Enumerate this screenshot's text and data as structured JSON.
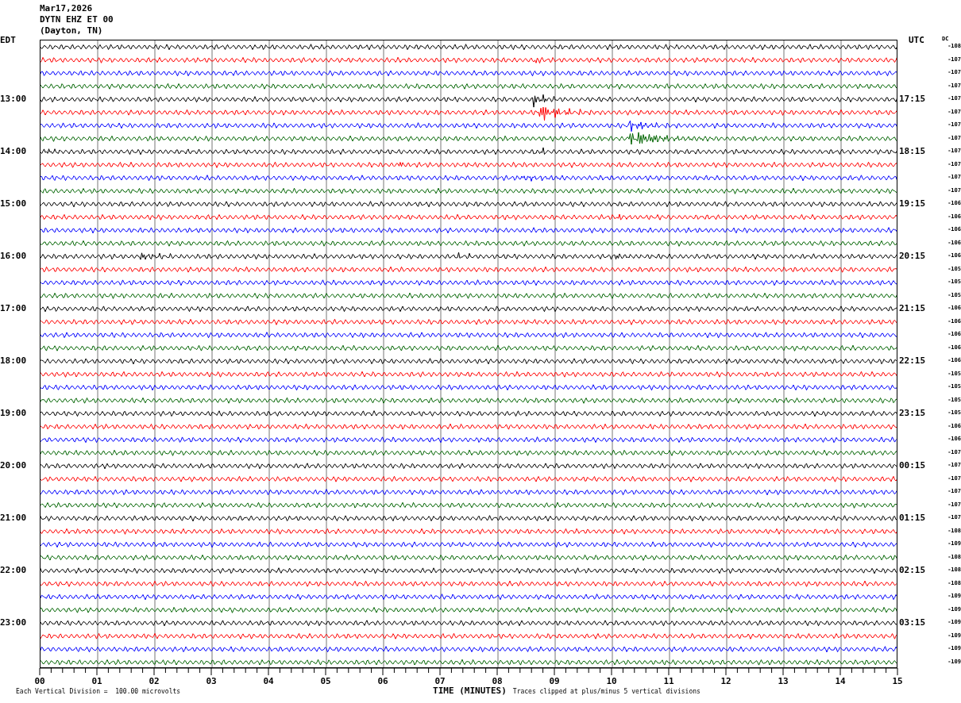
{
  "header": {
    "date": "Mar17,2026",
    "station": "DYTN EHZ ET 00",
    "location": "(Dayton, TN)"
  },
  "left_heading": "EDT",
  "right_heading": "UTC",
  "dc_heading": "DC",
  "rows": [
    {
      "color": "#000000",
      "dc": "-108"
    },
    {
      "color": "#ff0000",
      "dc": "-107"
    },
    {
      "color": "#0000ff",
      "dc": "-107"
    },
    {
      "color": "#006400",
      "dc": "-107"
    },
    {
      "color": "#000000",
      "dc": "-107",
      "left": "13:00",
      "right": "17:15"
    },
    {
      "color": "#ff0000",
      "dc": "-107"
    },
    {
      "color": "#0000ff",
      "dc": "-107"
    },
    {
      "color": "#006400",
      "dc": "-107"
    },
    {
      "color": "#000000",
      "dc": "-107",
      "left": "14:00",
      "right": "18:15"
    },
    {
      "color": "#ff0000",
      "dc": "-107"
    },
    {
      "color": "#0000ff",
      "dc": "-107"
    },
    {
      "color": "#006400",
      "dc": "-107"
    },
    {
      "color": "#000000",
      "dc": "-106",
      "left": "15:00",
      "right": "19:15"
    },
    {
      "color": "#ff0000",
      "dc": "-106"
    },
    {
      "color": "#0000ff",
      "dc": "-106"
    },
    {
      "color": "#006400",
      "dc": "-106"
    },
    {
      "color": "#000000",
      "dc": "-106",
      "left": "16:00",
      "right": "20:15"
    },
    {
      "color": "#ff0000",
      "dc": "-105"
    },
    {
      "color": "#0000ff",
      "dc": "-105"
    },
    {
      "color": "#006400",
      "dc": "-105"
    },
    {
      "color": "#000000",
      "dc": "-106",
      "left": "17:00",
      "right": "21:15"
    },
    {
      "color": "#ff0000",
      "dc": "-106"
    },
    {
      "color": "#0000ff",
      "dc": "-106"
    },
    {
      "color": "#006400",
      "dc": "-106"
    },
    {
      "color": "#000000",
      "dc": "-106",
      "left": "18:00",
      "right": "22:15"
    },
    {
      "color": "#ff0000",
      "dc": "-105"
    },
    {
      "color": "#0000ff",
      "dc": "-105"
    },
    {
      "color": "#006400",
      "dc": "-105"
    },
    {
      "color": "#000000",
      "dc": "-105",
      "left": "19:00",
      "right": "23:15"
    },
    {
      "color": "#ff0000",
      "dc": "-106"
    },
    {
      "color": "#0000ff",
      "dc": "-106"
    },
    {
      "color": "#006400",
      "dc": "-107"
    },
    {
      "color": "#000000",
      "dc": "-107",
      "left": "20:00",
      "right": "00:15"
    },
    {
      "color": "#ff0000",
      "dc": "-107"
    },
    {
      "color": "#0000ff",
      "dc": "-107"
    },
    {
      "color": "#006400",
      "dc": "-107"
    },
    {
      "color": "#000000",
      "dc": "-107",
      "left": "21:00",
      "right": "01:15"
    },
    {
      "color": "#ff0000",
      "dc": "-108"
    },
    {
      "color": "#0000ff",
      "dc": "-109"
    },
    {
      "color": "#006400",
      "dc": "-108"
    },
    {
      "color": "#000000",
      "dc": "-108",
      "left": "22:00",
      "right": "02:15"
    },
    {
      "color": "#ff0000",
      "dc": "-108"
    },
    {
      "color": "#0000ff",
      "dc": "-109"
    },
    {
      "color": "#006400",
      "dc": "-109"
    },
    {
      "color": "#000000",
      "dc": "-109",
      "left": "23:00",
      "right": "03:15"
    },
    {
      "color": "#ff0000",
      "dc": "-109"
    },
    {
      "color": "#0000ff",
      "dc": "-109"
    },
    {
      "color": "#006400",
      "dc": "-109"
    }
  ],
  "x_ticks": [
    "00",
    "01",
    "02",
    "03",
    "04",
    "05",
    "06",
    "07",
    "08",
    "09",
    "10",
    "11",
    "12",
    "13",
    "14",
    "15"
  ],
  "footer": {
    "scale_note": "Each Vertical Division =  100.00 microvolts",
    "axis_title": "TIME (MINUTES)",
    "clip_note": "Traces clipped at plus/minus 5 vertical divisions"
  }
}
